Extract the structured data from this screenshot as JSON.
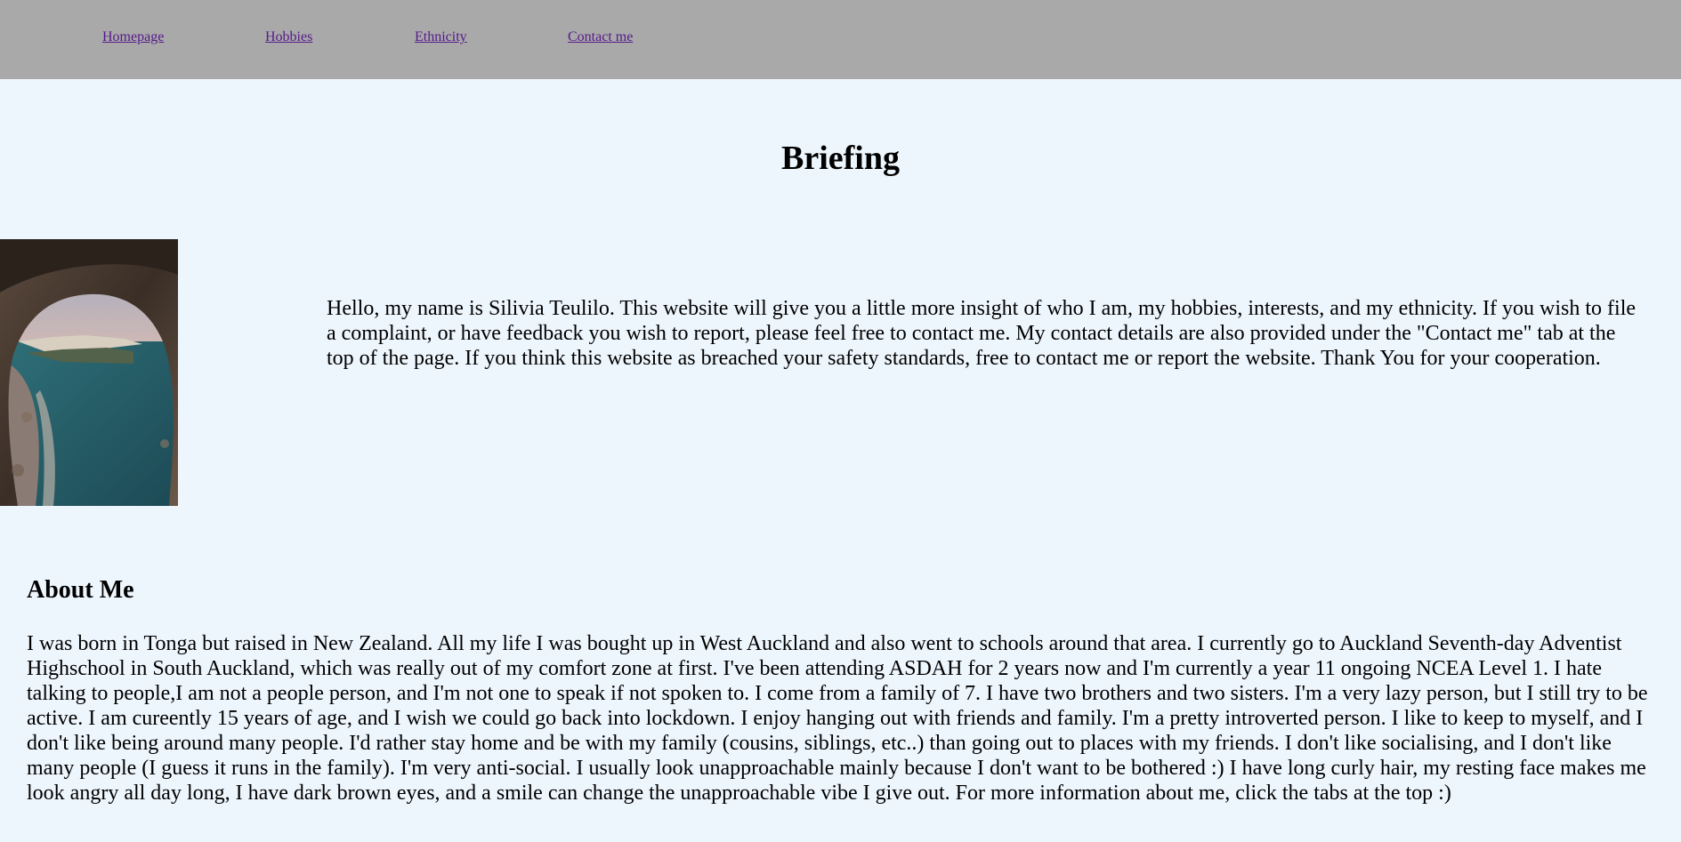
{
  "nav": {
    "items": [
      {
        "label": "Homepage"
      },
      {
        "label": "Hobbies"
      },
      {
        "label": "Ethnicity"
      },
      {
        "label": "Contact me"
      }
    ]
  },
  "briefing": {
    "title": "Briefing",
    "text": "Hello, my name is Silivia Teulilo. This website will give you a little more insight of who I am, my hobbies, interests, and my ethnicity. If you wish to file a complaint, or have feedback you wish to report, please feel free to contact me. My contact details are also provided under the \"Contact me\" tab at the top of the page. If you think this website as breached your safety standards, free to contact me or report the website. Thank You for your cooperation."
  },
  "about": {
    "heading": "About Me",
    "text": "I was born in Tonga but raised in New Zealand. All my life I was bought up in West Auckland and also went to schools around that area. I currently go to Auckland Seventh-day Adventist Highschool in South Auckland, which was really out of my comfort zone at first. I've been attending ASDAH for 2 years now and I'm currently a year 11 ongoing NCEA Level 1. I hate talking to people,I am not a people person, and I'm not one to speak if not spoken to. I come from a family of 7. I have two brothers and two sisters. I'm a very lazy person, but I still try to be active. I am cureently 15 years of age, and I wish we could go back into lockdown. I enjoy hanging out with friends and family. I'm a pretty introverted person. I like to keep to myself, and I don't like being around many people. I'd rather stay home and be with my family (cousins, siblings, etc..) than going out to places with my friends. I don't like socialising, and I don't like many people (I guess it runs in the family). I'm very anti-social. I usually look unapproachable mainly because I don't want to be bothered :) I have long curly hair, my resting face makes me look angry all day long, I have dark brown eyes, and a smile can change the unapproachable vibe I give out. For more information about me, click the tabs at the top :)"
  },
  "colors": {
    "page_background": "#eef6fd",
    "nav_background": "#a9a9a9",
    "link": "#551a8b"
  }
}
